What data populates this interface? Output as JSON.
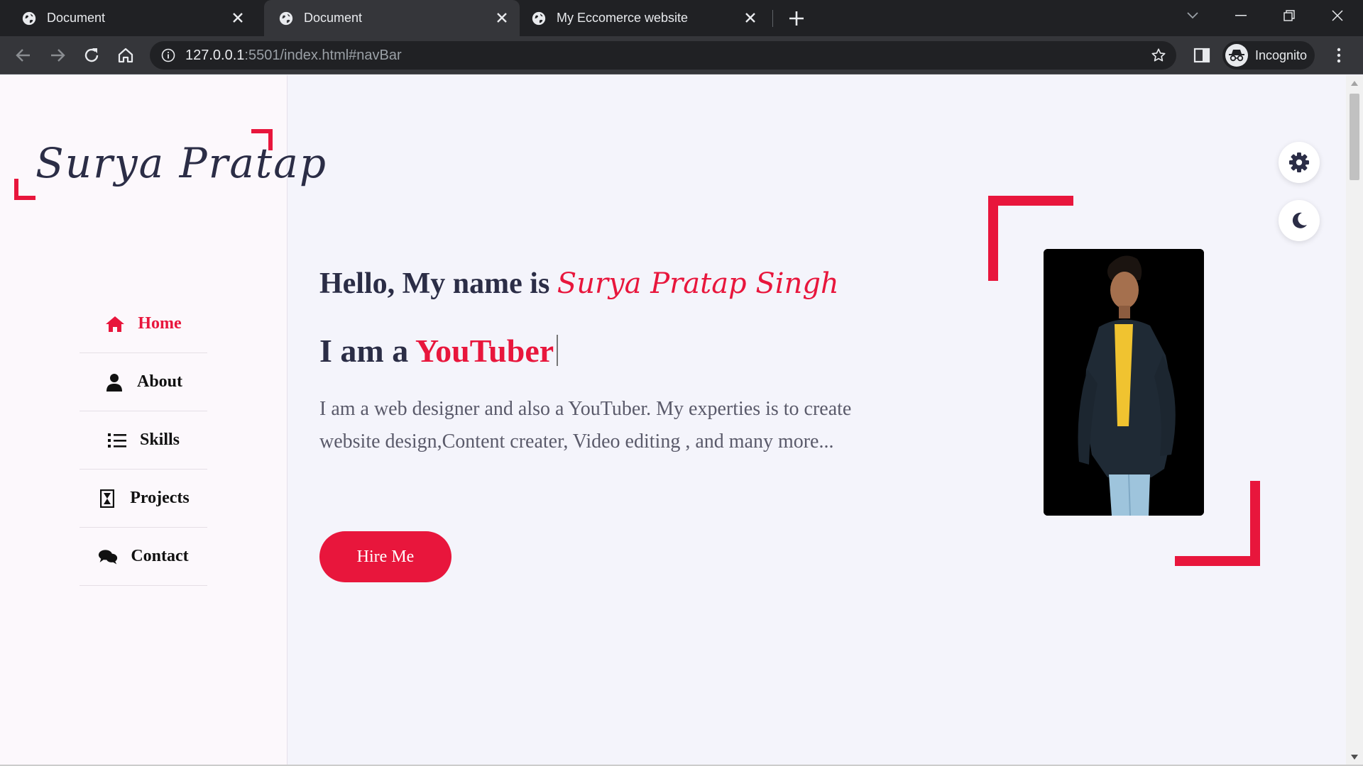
{
  "browser": {
    "tabs": [
      {
        "title": "Document",
        "active": false
      },
      {
        "title": "Document",
        "active": true
      },
      {
        "title": "My Eccomerce website",
        "active": false
      }
    ],
    "url_host": "127.0.0.1",
    "url_rest": ":5501/index.html#navBar",
    "profile_label": "Incognito"
  },
  "sidebar": {
    "logo": "Surya Pratap",
    "items": [
      {
        "label": "Home",
        "icon": "home-icon",
        "active": true
      },
      {
        "label": "About",
        "icon": "user-icon",
        "active": false
      },
      {
        "label": "Skills",
        "icon": "list-icon",
        "active": false
      },
      {
        "label": "Projects",
        "icon": "hourglass-icon",
        "active": false
      },
      {
        "label": "Contact",
        "icon": "comments-icon",
        "active": false
      }
    ]
  },
  "hero": {
    "greeting": "Hello, My name is ",
    "name": "Surya Pratap Singh",
    "iam_prefix": "I am a ",
    "role": "YouTuber",
    "description": "I am a web designer and also a YouTuber. My experties is to create website design,Content creater, Video editing , and many more...",
    "cta": "Hire Me"
  },
  "colors": {
    "accent": "#e8163c",
    "text_dark": "#2b2d46"
  }
}
